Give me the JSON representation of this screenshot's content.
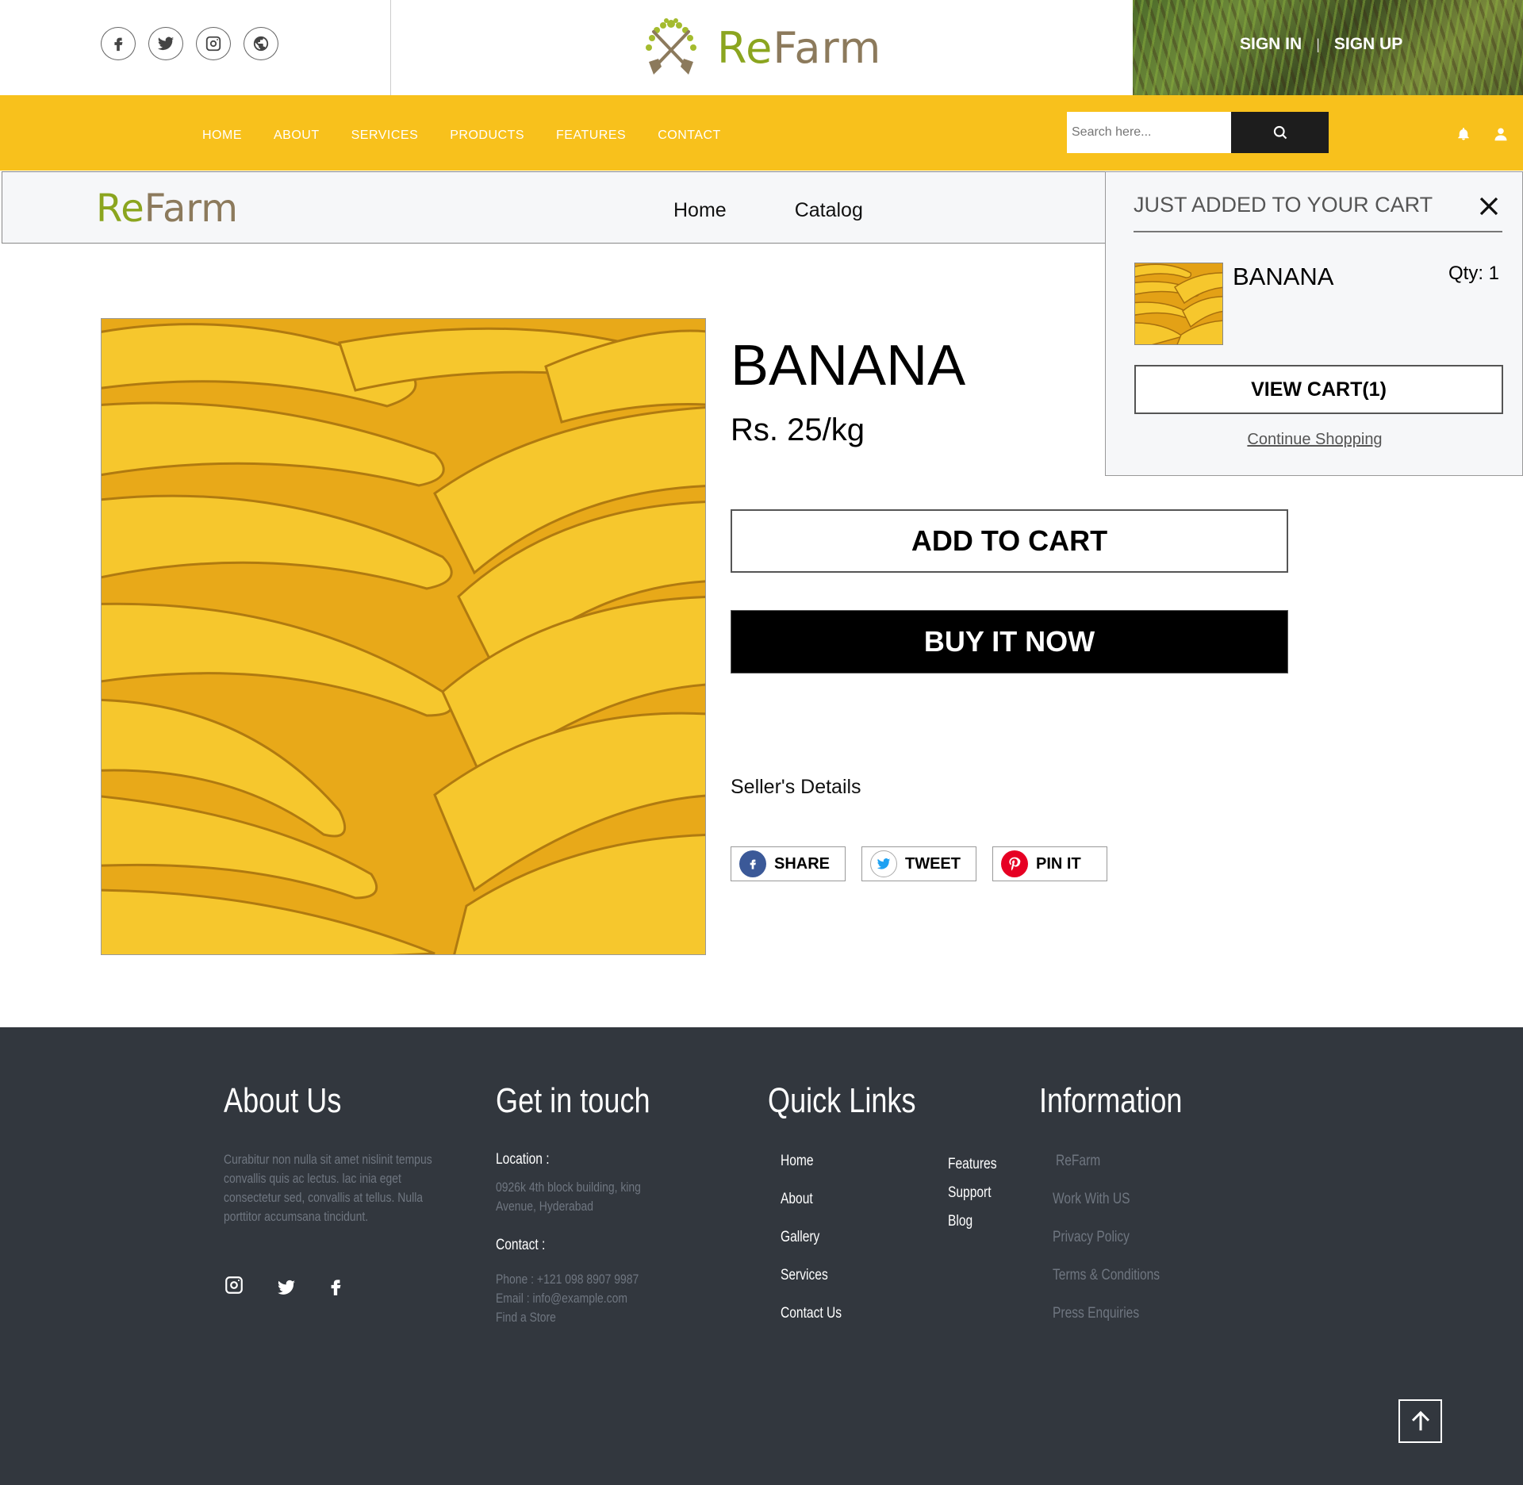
{
  "header": {
    "social_icons": [
      "facebook-icon",
      "twitter-icon",
      "instagram-icon",
      "globe-icon"
    ],
    "logo_re": "Re",
    "logo_farm": "Farm",
    "sign_in": "SIGN IN",
    "separator": "|",
    "sign_up": "SIGN UP"
  },
  "nav": {
    "items": [
      "HOME",
      "ABOUT",
      "SERVICES",
      "PRODUCTS",
      "FEATURES",
      "CONTACT"
    ],
    "search_placeholder": "Search here...",
    "accent": "#f8c11c"
  },
  "store_nav": {
    "logo_re": "Re",
    "logo_farm": "Farm",
    "links": [
      "Home",
      "Catalog"
    ]
  },
  "product": {
    "title": "BANANA",
    "price": "Rs. 25/kg",
    "add_to_cart": "ADD TO CART",
    "buy_now": "BUY IT NOW",
    "seller_details": "Seller's Details",
    "share": [
      "SHARE",
      "TWEET",
      "PIN IT"
    ]
  },
  "cart_popup": {
    "heading": "JUST ADDED TO YOUR CART",
    "item_name": "BANANA",
    "qty": "Qty: 1",
    "view_cart": "VIEW CART(1)",
    "continue": "Continue Shopping"
  },
  "footer": {
    "about": {
      "title": "About Us",
      "text": "Curabitur non nulla sit amet nislinit tempus convallis quis ac lectus. lac inia eget consectetur sed, convallis at tellus. Nulla porttitor accumsana tincidunt."
    },
    "touch": {
      "title": "Get in touch",
      "location_label": "Location :",
      "location": "0926k 4th block building, king Avenue, Hyderabad",
      "contact_label": "Contact :",
      "phone": "Phone : +121 098 8907 9987",
      "email": "Email : info@example.com",
      "store": "Find a Store"
    },
    "quick": {
      "title": "Quick Links",
      "col1": [
        "Home",
        "About",
        "Gallery",
        "Services",
        "Contact Us"
      ],
      "col2": [
        "Features",
        "Support",
        "Blog"
      ]
    },
    "info": {
      "title": "Information",
      "items": [
        "ReFarm",
        "Work With US",
        "Privacy Policy",
        "Terms & Conditions",
        "Press Enquiries"
      ]
    }
  }
}
